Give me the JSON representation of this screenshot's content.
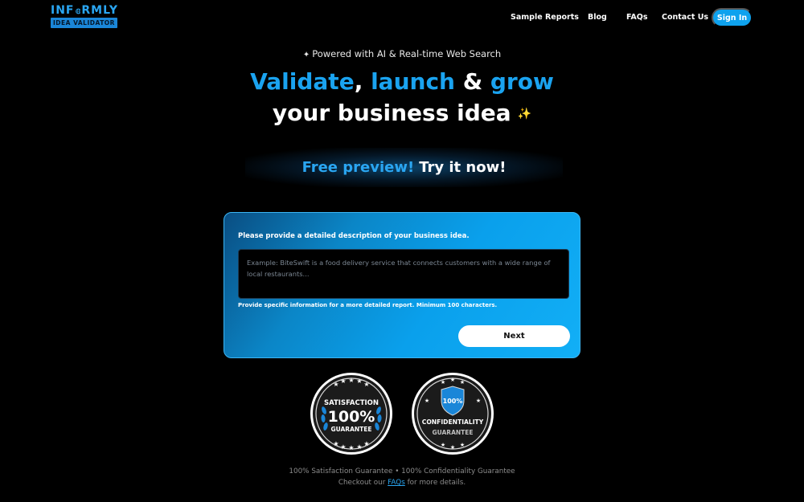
{
  "logo": {
    "text_left": "INF",
    "text_right": "RMLY",
    "subtitle": "IDEA VALIDATOR"
  },
  "nav": {
    "items": [
      {
        "label": "Sample Reports"
      },
      {
        "label": "Blog"
      },
      {
        "label": "FAQs"
      },
      {
        "label": "Contact Us"
      }
    ],
    "signin_label": "Sign In"
  },
  "hero": {
    "powered_text": "Powered with AI & Real-time Web Search",
    "headline_validate": "Validate",
    "headline_comma": ",",
    "headline_launch": "launch",
    "headline_amp": "&",
    "headline_grow": "grow",
    "headline_line2": "your business idea",
    "sparkle": "✨",
    "preview_blue": "Free preview!",
    "preview_white": "Try it now!"
  },
  "form": {
    "label": "Please provide a detailed description of your business idea.",
    "placeholder": "Example: BiteSwift is a food delivery service that connects customers with a wide range of local restaurants...",
    "hint": "Provide specific information for a more detailed report. Minimum 100 characters.",
    "next_label": "Next"
  },
  "badges": {
    "satisfaction": {
      "top": "SATISFACTION",
      "middle": "100%",
      "bottom": "GUARANTEE"
    },
    "confidentiality": {
      "shield": "100%",
      "top": "CONFIDENTIALITY",
      "bottom": "GUARANTEE"
    }
  },
  "footer": {
    "line1": "100% Satisfaction Guarantee • 100% Confidentiality Guarantee",
    "line2_before": "Checkout our",
    "line2_link": "FAQs",
    "line2_after": "for more details."
  },
  "colors": {
    "accent": "#1aa3f0",
    "background": "#000000",
    "card_gradient_start": "#0a4e82",
    "card_gradient_end": "#12aff6"
  }
}
